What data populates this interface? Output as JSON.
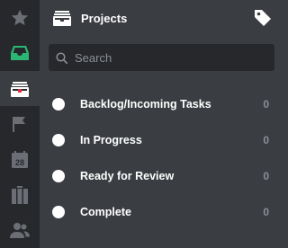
{
  "rail": {
    "items": [
      {
        "icon": "star-icon",
        "color": "#6b6e74"
      },
      {
        "icon": "inbox-icon",
        "color": "#2bb673"
      },
      {
        "icon": "projects-icon",
        "color": "#ffffff",
        "active": true
      },
      {
        "icon": "flag-icon",
        "color": "#6b6e74"
      },
      {
        "icon": "calendar-icon",
        "color": "#6b6e74",
        "label": "28"
      },
      {
        "icon": "briefcase-icon",
        "color": "#6b6e74"
      },
      {
        "icon": "people-icon",
        "color": "#6b6e74"
      }
    ]
  },
  "header": {
    "title": "Projects"
  },
  "search": {
    "placeholder": "Search"
  },
  "projects": [
    {
      "label": "Backlog/Incoming Tasks",
      "count": "0"
    },
    {
      "label": "In Progress",
      "count": "0"
    },
    {
      "label": "Ready for Review",
      "count": "0"
    },
    {
      "label": "Complete",
      "count": "0"
    }
  ]
}
